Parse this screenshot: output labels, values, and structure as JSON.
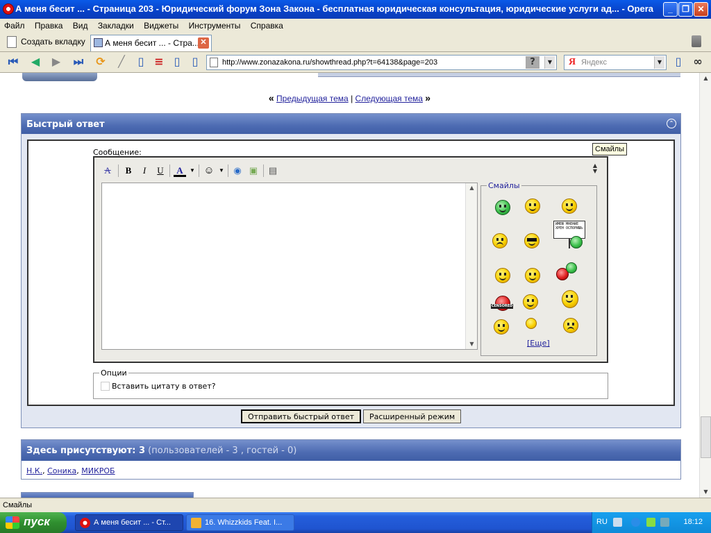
{
  "window": {
    "title": "А меня бесит ... - Страница 203 - Юридический форум Зона Закона - бесплатная юридическая консультация, юридические услуги ад... - Opera",
    "minimize": "_",
    "maximize": "❐",
    "close": "✕"
  },
  "menu": [
    "Файл",
    "Правка",
    "Вид",
    "Закладки",
    "Виджеты",
    "Инструменты",
    "Справка"
  ],
  "tabs": {
    "new_tab_label": "Создать вкладку",
    "active_tab_label": "А меня бесит ... - Стра...",
    "close_glyph": "✕"
  },
  "address": {
    "url": "http://www.zonazakona.ru/showthread.php?t=64138&page=203",
    "help_glyph": "?",
    "search_placeholder": "Яндекс",
    "search_engine_glyph": "Я"
  },
  "page": {
    "thread_nav": {
      "prev_label": "Предыдущая тема",
      "separator": "|",
      "next_label": "Следующая тема",
      "left_guillemets": "«",
      "right_guillemets": "»"
    },
    "quick_reply": {
      "title": "Быстрый ответ",
      "message_label": "Сообщение:",
      "toolbar": {
        "bold": "B",
        "italic": "I",
        "underline": "U",
        "font_color": "A"
      },
      "smilies_legend": "Смайлы",
      "smilies_more": "[Еще]",
      "sign_text": "ИМЕЮ МНЕНИЕ ХРЕН ОСПОРИШЬ",
      "censored_text": "CENSORED",
      "tooltip": "Смайлы",
      "options_legend": "Опции",
      "quote_checkbox_label": "Вставить цитату в ответ?",
      "submit_button": "Отправить быстрый ответ",
      "advanced_button": "Расширенный режим"
    },
    "present": {
      "title_bold": "Здесь присутствуют: 3",
      "title_sub": "(пользователей - 3 , гостей - 0)",
      "users": [
        "Н.К.",
        "Соника",
        "МИКРОБ"
      ],
      "user_separator": ","
    }
  },
  "status_text": "Смайлы",
  "taskbar": {
    "start_label": "пуск",
    "items": [
      "А меня бесит ... - Ст...",
      "16. Whizzkids Feat. I..."
    ],
    "language": "RU",
    "clock": "18:12"
  },
  "colors": {
    "header_blue": "#4d6bb2",
    "link_blue": "#22229c",
    "panel_bg": "#e2e7f2"
  }
}
